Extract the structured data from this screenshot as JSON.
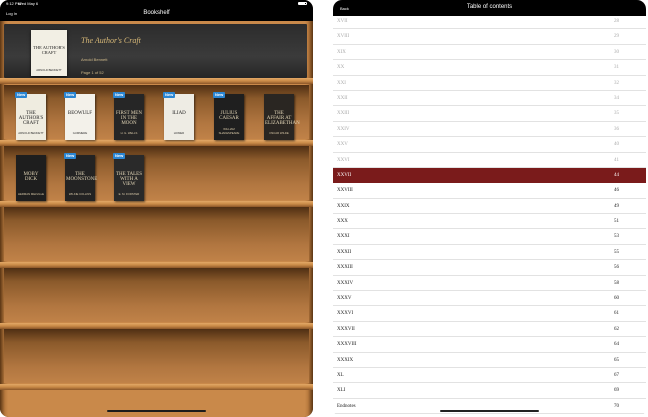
{
  "left": {
    "status": {
      "time": "9:12 PM",
      "date": "Wed May 6"
    },
    "nav": {
      "login": "Log In",
      "title": "Bookshelf"
    },
    "featured": {
      "title": "The Author's Craft",
      "author": "Arnold Bennett",
      "page": "Page 1 of 52",
      "cover_title": "THE AUTHOR'S CRAFT",
      "cover_author": "ARNOLD BENNETT"
    },
    "new_badge": "New",
    "books": [
      {
        "title": "THE AUTHOR'S CRAFT",
        "sub": "ARNOLD BENNETT",
        "bg": "#efece0",
        "light": true,
        "new": true
      },
      {
        "title": "BEOWULF",
        "sub": "GUMMERE",
        "bg": "#f3f1ea",
        "light": true,
        "new": true
      },
      {
        "title": "FIRST MEN IN THE MOON",
        "sub": "H. G. WELLS",
        "bg": "#262626",
        "light": false,
        "new": true
      },
      {
        "title": "ILIAD",
        "sub": "HOMER",
        "bg": "#eeece4",
        "light": true,
        "new": true
      },
      {
        "title": "JULIUS CAESAR",
        "sub": "WILLIAM SHAKESPEARE",
        "bg": "#1f1f1f",
        "light": false,
        "new": true
      },
      {
        "title": "THE AFFAIR AT ELIZABETHAN",
        "sub": "OSCAR WILDE",
        "bg": "#2a2622",
        "light": false,
        "new": false
      },
      {
        "title": "MOBY DICK",
        "sub": "HERMAN MELVILLE",
        "bg": "#1e1e1e",
        "light": false,
        "new": false
      },
      {
        "title": "THE MOONSTONE",
        "sub": "WILKIE COLLINS",
        "bg": "#232323",
        "light": false,
        "new": true
      },
      {
        "title": "THE TALES WITH A VIEW",
        "sub": "E. M. FORSTER",
        "bg": "#2a2a2a",
        "light": false,
        "new": true
      }
    ]
  },
  "right": {
    "nav": {
      "back": "Back",
      "title": "Table of contents"
    },
    "toc": [
      {
        "label": "XVII",
        "page": "28"
      },
      {
        "label": "XVIII",
        "page": "29"
      },
      {
        "label": "XIX",
        "page": "30"
      },
      {
        "label": "XX",
        "page": "31"
      },
      {
        "label": "XXI",
        "page": "32"
      },
      {
        "label": "XXII",
        "page": "34"
      },
      {
        "label": "XXIII",
        "page": "35"
      },
      {
        "label": "XXIV",
        "page": "36"
      },
      {
        "label": "XXV",
        "page": "40"
      },
      {
        "label": "XXVI",
        "page": "41"
      },
      {
        "label": "XXVII",
        "page": "44"
      },
      {
        "label": "XXVIII",
        "page": "46"
      },
      {
        "label": "XXIX",
        "page": "49"
      },
      {
        "label": "XXX",
        "page": "51"
      },
      {
        "label": "XXXI",
        "page": "53"
      },
      {
        "label": "XXXII",
        "page": "55"
      },
      {
        "label": "XXXIII",
        "page": "56"
      },
      {
        "label": "XXXIV",
        "page": "58"
      },
      {
        "label": "XXXV",
        "page": "60"
      },
      {
        "label": "XXXVI",
        "page": "61"
      },
      {
        "label": "XXXVII",
        "page": "62"
      },
      {
        "label": "XXXVIII",
        "page": "64"
      },
      {
        "label": "XXXIX",
        "page": "65"
      },
      {
        "label": "XL",
        "page": "67"
      },
      {
        "label": "XLI",
        "page": "69"
      },
      {
        "label": "Endnotes",
        "page": "70"
      }
    ],
    "selected_label": "XXVII"
  },
  "colors": {
    "selected_row": "#7a1b1b",
    "new_badge": "#2a86d4",
    "wood": "#c9894a"
  }
}
